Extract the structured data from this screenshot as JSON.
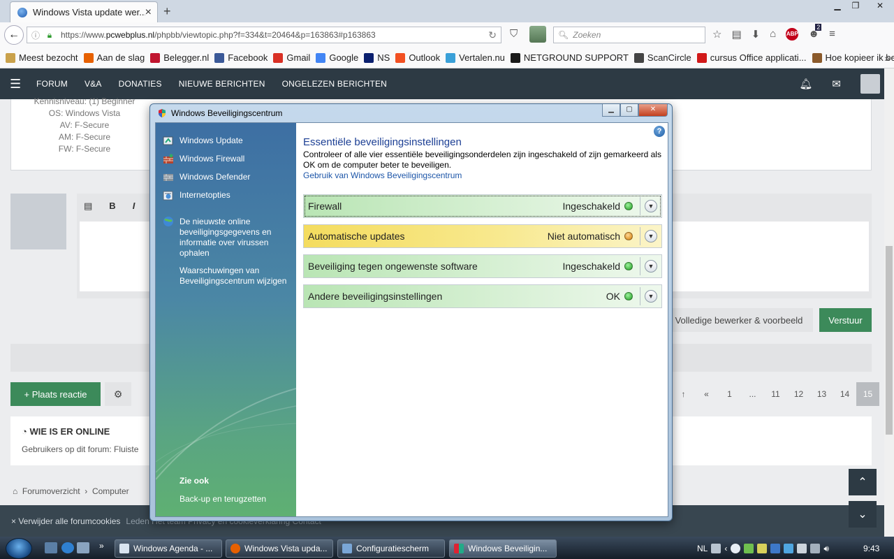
{
  "browser": {
    "tab_title": "Windows Vista update wer...",
    "url_prefix": "https://www.",
    "url_domain": "pcwebplus.nl",
    "url_path": "/phpbb/viewtopic.php?f=334&t=20464&p=163863#p163863",
    "search_placeholder": "Zoeken",
    "badge_count": "2",
    "bookmarks": [
      {
        "label": "Meest bezocht",
        "color": "#c9a14b"
      },
      {
        "label": "Aan de slag",
        "color": "#e66000"
      },
      {
        "label": "Belegger.nl",
        "color": "#c0152f"
      },
      {
        "label": "Facebook",
        "color": "#3b5998"
      },
      {
        "label": "Gmail",
        "color": "#d93025"
      },
      {
        "label": "Google",
        "color": "#4285f4"
      },
      {
        "label": "NS",
        "color": "#0a1f6e"
      },
      {
        "label": "Outlook",
        "color": "#f25022"
      },
      {
        "label": "Vertalen.nu",
        "color": "#3aa0d8"
      },
      {
        "label": "NETGROUND SUPPORT",
        "color": "#1a1a1a"
      },
      {
        "label": "ScanCircle",
        "color": "#444444"
      },
      {
        "label": "cursus Office applicati...",
        "color": "#d11919"
      },
      {
        "label": "Hoe kopieer ik bestan...",
        "color": "#8b5a2b"
      }
    ]
  },
  "forum": {
    "nav": [
      "FORUM",
      "V&A",
      "DONATIES",
      "NIEUWE BERICHTEN",
      "ONGELEZEN BERICHTEN"
    ],
    "profile_lines": [
      "Kennisniveau: (1) Beginner",
      "OS: Windows Vista",
      "AV: F-Secure",
      "AM: F-Secure",
      "FW: F-Secure"
    ],
    "full_editor_btn": "Volledige bewerker & voorbeeld",
    "send_btn": "Verstuur",
    "reply_btn": "+ Plaats reactie",
    "pages": [
      "«",
      "1",
      "...",
      "11",
      "12",
      "13",
      "14",
      "15"
    ],
    "online_title": "WIE IS ER ONLINE",
    "online_text": "Gebruikers op dit forum: Fluiste",
    "crumb_1": "Forumoverzicht",
    "crumb_2": "Computer",
    "footer_link": "× Verwijder alle forumcookies",
    "footer_rest": "Leden   Het team   Privacy   en cookieverklaring   Contact"
  },
  "dialog": {
    "title": "Windows Beveiligingscentrum",
    "left_items": [
      {
        "label": "Windows Update",
        "icon": "windows-update-icon"
      },
      {
        "label": "Windows Firewall",
        "icon": "firewall-icon"
      },
      {
        "label": "Windows Defender",
        "icon": "defender-icon"
      },
      {
        "label": "Internetopties",
        "icon": "internet-options-icon"
      }
    ],
    "online_info": "De nieuwste online beveiligingsgegevens en informatie over virussen ophalen",
    "alerts_link": "Waarschuwingen van Beveiligingscentrum wijzigen",
    "see_also": "Zie ook",
    "backup": "Back-up en terugzetten",
    "heading": "Essentiële beveiligingsinstellingen",
    "description": "Controleer of alle vier essentiële beveiligingsonderdelen zijn ingeschakeld of zijn gemarkeerd als OK om de computer beter te beveiligen.",
    "usage_link": "Gebruik van Windows Beveiligingscentrum",
    "sections": [
      {
        "name": "Firewall",
        "status": "Ingeschakeld",
        "state": "ok"
      },
      {
        "name": "Automatische updates",
        "status": "Niet automatisch",
        "state": "warn"
      },
      {
        "name": "Beveiliging tegen ongewenste software",
        "status": "Ingeschakeld",
        "state": "ok"
      },
      {
        "name": "Andere beveiligingsinstellingen",
        "status": "OK",
        "state": "ok"
      }
    ]
  },
  "taskbar": {
    "tasks": [
      "Windows Agenda - ...",
      "Windows Vista upda...",
      "Configuratiescherm",
      "Windows Beveiligin..."
    ],
    "lang": "NL",
    "time": "9:43"
  }
}
